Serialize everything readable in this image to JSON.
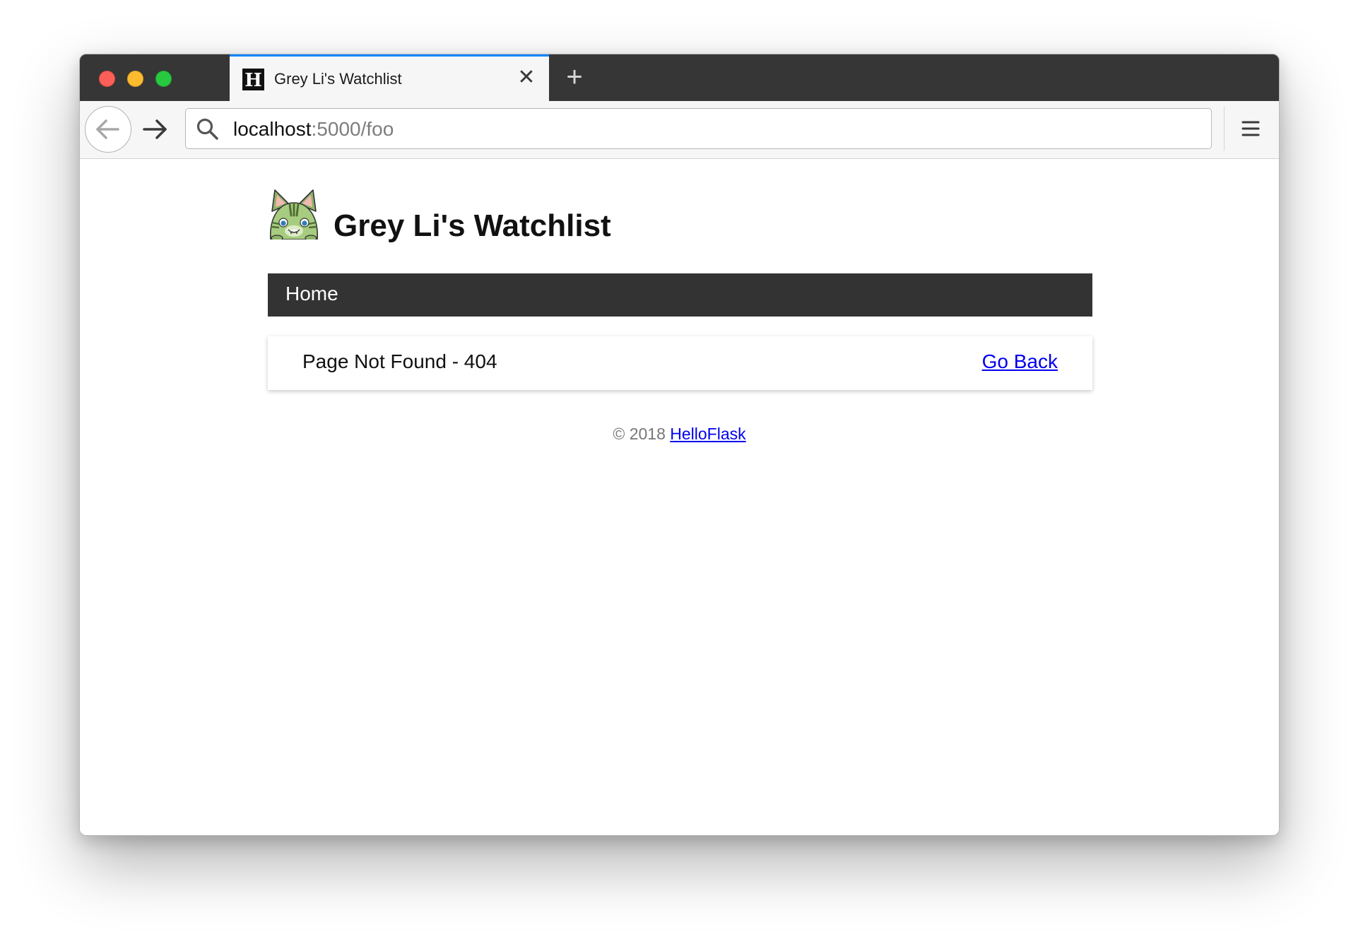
{
  "browser": {
    "tab": {
      "favicon_letter": "H",
      "title": "Grey Li's Watchlist",
      "close_glyph": "✕"
    },
    "new_tab_glyph": "+",
    "address_bar": {
      "host": "localhost",
      "path": ":5000/foo"
    },
    "accent_color": "#0a84ff",
    "icons": {
      "back": "arrow-left-icon",
      "forward": "arrow-right-icon",
      "search": "search-icon",
      "menu": "hamburger-menu-icon",
      "close": "close-icon",
      "new_tab": "plus-icon"
    }
  },
  "page": {
    "header": {
      "title": "Grey Li's Watchlist",
      "avatar_icon": "cat-avatar-icon"
    },
    "nav": {
      "items": [
        {
          "label": "Home"
        }
      ]
    },
    "error_card": {
      "message": "Page Not Found - 404",
      "link_label": "Go Back"
    },
    "footer": {
      "copyright": "© 2018 ",
      "link_label": "HelloFlask"
    }
  }
}
